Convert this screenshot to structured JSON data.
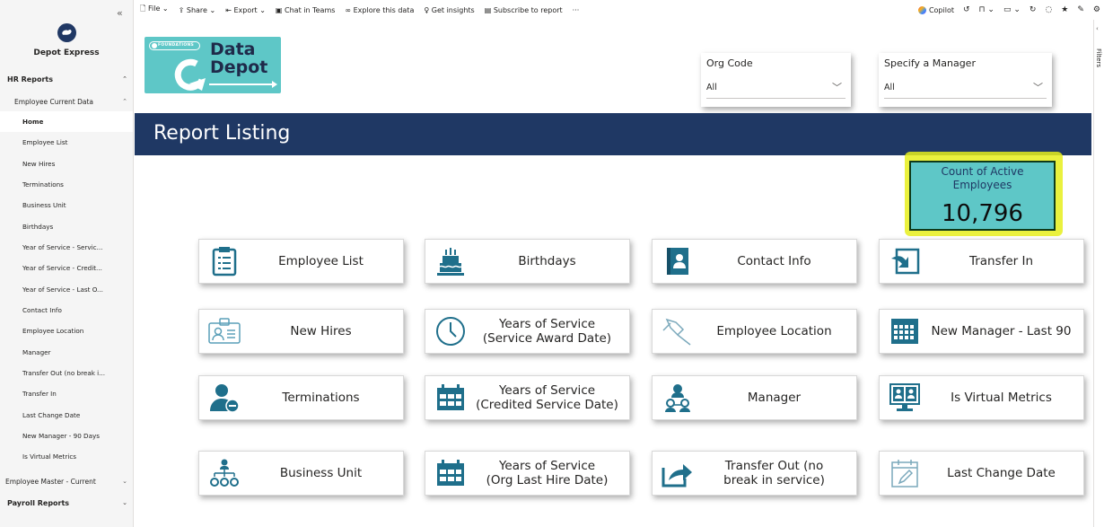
{
  "nav": {
    "app_name": "Depot Express",
    "sections": [
      {
        "label": "HR Reports"
      },
      {
        "label": "Employee Current Data"
      }
    ],
    "items": [
      {
        "label": "Home"
      },
      {
        "label": "Employee List"
      },
      {
        "label": "New Hires"
      },
      {
        "label": "Terminations"
      },
      {
        "label": "Business Unit"
      },
      {
        "label": "Birthdays"
      },
      {
        "label": "Year of Service - Servic..."
      },
      {
        "label": "Year of Service - Credit..."
      },
      {
        "label": "Year of Service - Last O..."
      },
      {
        "label": "Contact Info"
      },
      {
        "label": "Employee Location"
      },
      {
        "label": "Manager"
      },
      {
        "label": "Transfer Out (no break i..."
      },
      {
        "label": "Transfer In"
      },
      {
        "label": "Last Change Date"
      },
      {
        "label": "New Manager - 90 Days"
      },
      {
        "label": "Is Virtual Metrics"
      }
    ],
    "employee_master": "Employee Master - Current",
    "payroll": "Payroll Reports"
  },
  "toolbar": {
    "file": "File",
    "share": "Share",
    "export": "Export",
    "chat": "Chat in Teams",
    "explore": "Explore this data",
    "insights": "Get insights",
    "subscribe": "Subscribe to report",
    "more": "···",
    "copilot": "Copilot"
  },
  "filters_label": "Filters",
  "brand": {
    "badge": "FOUNDATIONS",
    "line1": "Data",
    "line2": "Depot"
  },
  "slicers": [
    {
      "label": "Org Code",
      "value": "All"
    },
    {
      "label": "Specify a Manager",
      "value": "All"
    }
  ],
  "banner_title": "Report Listing",
  "kpi": {
    "label": "Count of Active Employees",
    "value": "10,796"
  },
  "tiles": [
    {
      "label": "Employee List",
      "icon": "clipboard-icon"
    },
    {
      "label": "Birthdays",
      "icon": "cake-icon"
    },
    {
      "label": "Contact Info",
      "icon": "contact-book-icon"
    },
    {
      "label": "Transfer In",
      "icon": "transfer-in-icon"
    },
    {
      "label": "New Hires",
      "icon": "id-badge-icon"
    },
    {
      "label": "Years of Service\n(Service Award Date)",
      "icon": "clock-icon"
    },
    {
      "label": "Employee Location",
      "icon": "map-pin-icon"
    },
    {
      "label": "New Manager - Last 90",
      "icon": "calendar-grid-icon"
    },
    {
      "label": "Terminations",
      "icon": "user-remove-icon"
    },
    {
      "label": "Years of Service\n(Credited Service Date)",
      "icon": "calendar-icon"
    },
    {
      "label": "Manager",
      "icon": "manager-icon"
    },
    {
      "label": "Is Virtual Metrics",
      "icon": "monitor-users-icon"
    },
    {
      "label": "Business Unit",
      "icon": "org-chart-icon"
    },
    {
      "label": "Years of Service\n(Org Last Hire Date)",
      "icon": "calendar-icon"
    },
    {
      "label": "Transfer Out (no\nbreak in service)",
      "icon": "share-arrow-icon"
    },
    {
      "label": "Last Change Date",
      "icon": "calendar-edit-icon"
    }
  ],
  "colors": {
    "navy": "#1f3864",
    "teal": "#5ec7c7",
    "highlight": "#e6ef1c"
  }
}
